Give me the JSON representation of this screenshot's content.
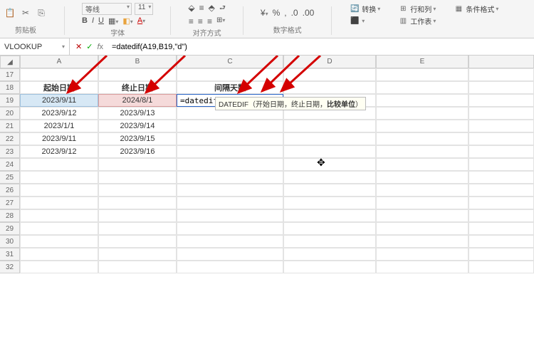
{
  "ribbon": {
    "groups": {
      "clipboard": {
        "label": "剪贴板"
      },
      "font": {
        "label": "字体",
        "name": "等线",
        "size": "11"
      },
      "align": {
        "label": "对齐方式"
      },
      "number": {
        "label": "数字格式"
      },
      "right": {
        "insert": "转换",
        "rowcol": "行和列",
        "sheet": "工作表",
        "cond": "条件格式"
      }
    }
  },
  "namebox": "VLOOKUP",
  "formula": "=datedif(A19,B19,\"d\")",
  "columns": [
    "A",
    "B",
    "C",
    "D",
    "E"
  ],
  "rowStart": 17,
  "rows": [
    {
      "A": "",
      "B": "",
      "C": ""
    },
    {
      "A": "起始日期",
      "B": "终止日期",
      "C": "间隔天数",
      "header": true
    },
    {
      "A": "2023/9/11",
      "B": "2024/8/1",
      "Cedit": true,
      "hilite": true
    },
    {
      "A": "2023/9/12",
      "B": "2023/9/13"
    },
    {
      "A": "2023/1/1",
      "B": "2023/9/14"
    },
    {
      "A": "2023/9/11",
      "B": "2023/9/15"
    },
    {
      "A": "2023/9/12",
      "B": "2023/9/16"
    },
    {},
    {},
    {},
    {},
    {},
    {},
    {},
    {},
    {}
  ],
  "editTokens": {
    "fn": "=datedif(",
    "a": "A19",
    "sep1": ", ",
    "b": "B19",
    "sep2": ",\"",
    "s": "d",
    "end": "\")"
  },
  "tooltip": {
    "fn": "DATEDIF",
    "args": "（开始日期，终止日期，",
    "bold": "比较单位",
    "tail": "）"
  },
  "chart_data": null
}
